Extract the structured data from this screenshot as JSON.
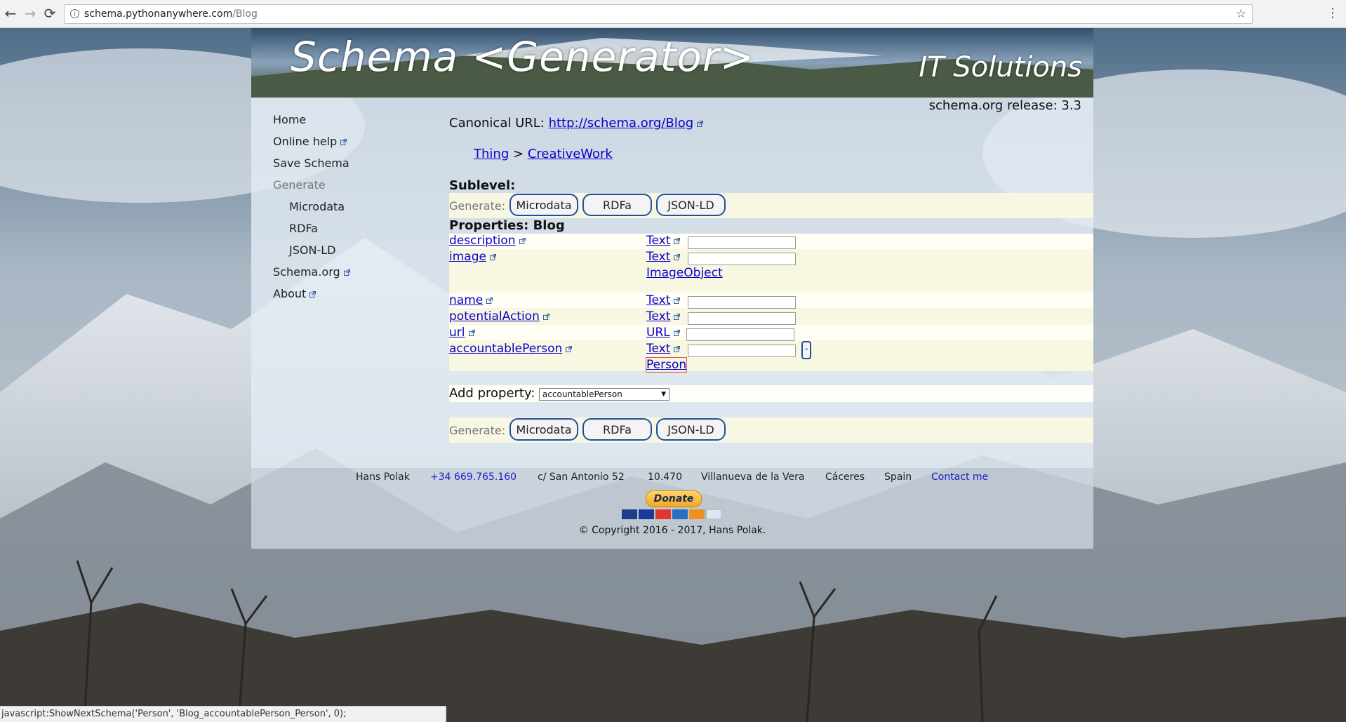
{
  "browser": {
    "url_host": "schema.pythonanywhere.com",
    "url_path": "/Blog",
    "status_text": "javascript:ShowNextSchema('Person', 'Blog_accountablePerson_Person', 0);"
  },
  "header": {
    "title": "Schema <Generator>",
    "subtitle": "IT Solutions",
    "release": "schema.org release: 3.3"
  },
  "sidebar": {
    "items": [
      {
        "label": "Home"
      },
      {
        "label": "Online help"
      },
      {
        "label": "Save Schema"
      },
      {
        "label": "Generate"
      },
      {
        "label": "Microdata"
      },
      {
        "label": "RDFa"
      },
      {
        "label": "JSON-LD"
      },
      {
        "label": "Schema.org"
      },
      {
        "label": "About"
      }
    ]
  },
  "main": {
    "canonical_label": "Canonical URL:",
    "canonical_url": "http://schema.org/Blog",
    "breadcrumb": [
      "Thing",
      "CreativeWork"
    ],
    "breadcrumb_sep": ">",
    "sublevel_label": "Sublevel:",
    "generate_label": "Generate:",
    "generate_buttons": [
      "Microdata",
      "RDFa",
      "JSON-LD"
    ],
    "properties_title": "Properties: Blog",
    "properties": [
      {
        "name": "description",
        "types": [
          "Text"
        ]
      },
      {
        "name": "image",
        "types": [
          "Text",
          "ImageObject"
        ]
      },
      {
        "name": "name",
        "types": [
          "Text"
        ]
      },
      {
        "name": "potentialAction",
        "types": [
          "Text"
        ]
      },
      {
        "name": "url",
        "types": [
          "URL"
        ]
      },
      {
        "name": "accountablePerson",
        "types": [
          "Text",
          "Person"
        ],
        "remove_symbol": "-"
      }
    ],
    "add_property_label": "Add property:",
    "add_property_selected": "accountablePerson"
  },
  "footer": {
    "name": "Hans Polak",
    "phone": "+34 669.765.160",
    "street": "c/ San Antonio 52",
    "zip": "10.470",
    "town": "Villanueva de la Vera",
    "province": "Cáceres",
    "country": "Spain",
    "contact": "Contact me",
    "donate": "Donate",
    "copyright": "© Copyright 2016 - 2017, Hans Polak."
  },
  "colors": {
    "link": "#0b00cc",
    "button_border": "#1f4f99",
    "band": "#faf8e1"
  }
}
